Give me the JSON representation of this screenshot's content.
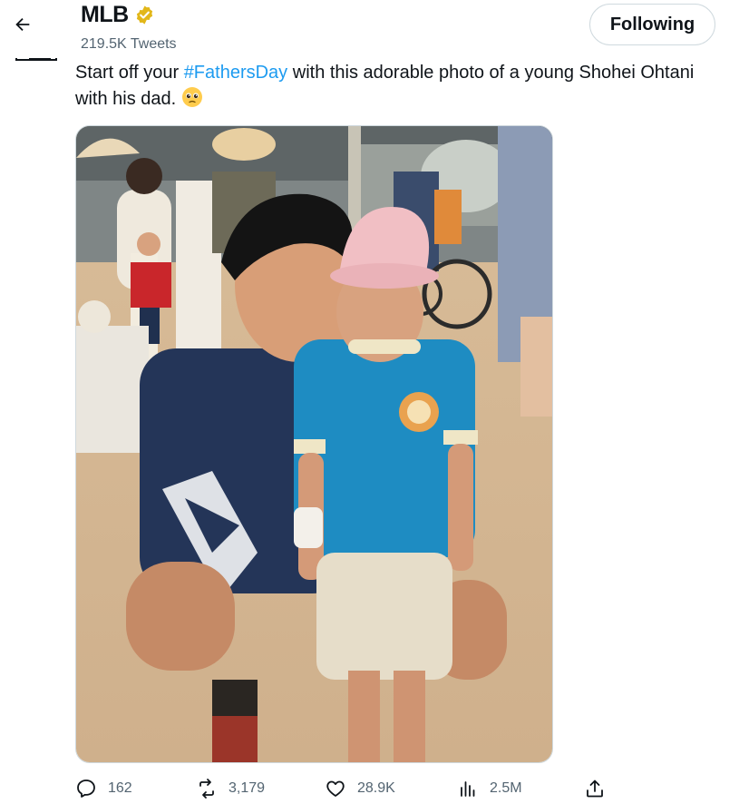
{
  "header": {
    "back_icon": "arrow-left-icon",
    "account_name": "MLB",
    "verified_icon": "gold-verified-badge-icon",
    "tweet_count": "219.5K Tweets",
    "follow_label": "Following"
  },
  "tweet": {
    "text_before": "Start off your ",
    "hashtag": "#FathersDay",
    "text_after": " with this adorable photo of a young Shohei Ohtani with his dad.",
    "emoji": "pleading-face-emoji",
    "photo": "photo of a crouching man with a small boy in a pink cap and blue shirt"
  },
  "actions": {
    "replies": "162",
    "retweets": "3,179",
    "likes": "28.9K",
    "views": "2.5M"
  },
  "colors": {
    "accent": "#1d9bf0",
    "text": "#0f1419",
    "muted": "#536471",
    "verified": "#e2b719"
  }
}
